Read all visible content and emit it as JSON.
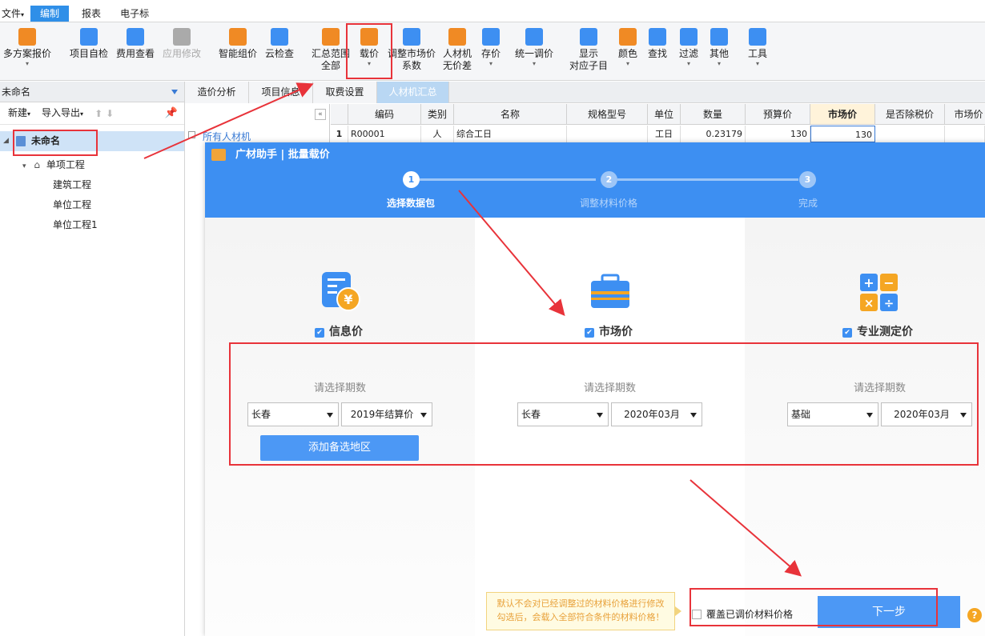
{
  "menu": {
    "items": [
      "文件",
      "编制",
      "报表",
      "电子标"
    ],
    "active_index": 1
  },
  "toolbar": {
    "buttons": [
      {
        "label": "多方案报价",
        "icon": "multi-plan-icon",
        "dropdown": true
      },
      {
        "label": "项目自检",
        "icon": "self-check-icon"
      },
      {
        "label": "费用查看",
        "icon": "fee-view-icon"
      },
      {
        "label": "应用修改",
        "icon": "apply-change-icon",
        "disabled": true
      },
      {
        "label": "智能组价",
        "icon": "smart-price-icon"
      },
      {
        "label": "云检查",
        "icon": "cloud-check-icon"
      },
      {
        "label": "汇总范围",
        "label2": "全部",
        "icon": "summary-range-icon"
      },
      {
        "label": "载价",
        "icon": "load-price-icon",
        "dropdown": true
      },
      {
        "label": "调整市场价",
        "label2": "系数",
        "icon": "adjust-market-icon"
      },
      {
        "label": "人材机",
        "label2": "无价差",
        "icon": "scale-icon"
      },
      {
        "label": "存价",
        "icon": "save-price-icon",
        "dropdown": true
      },
      {
        "label": "统一调价",
        "icon": "unify-price-icon",
        "dropdown": true
      },
      {
        "label": "显示",
        "label2": "对应子目",
        "icon": "show-sub-icon"
      },
      {
        "label": "颜色",
        "icon": "color-bucket-icon",
        "dropdown": true
      },
      {
        "label": "查找",
        "icon": "binoculars-icon"
      },
      {
        "label": "过滤",
        "icon": "filter-icon",
        "dropdown": true
      },
      {
        "label": "其他",
        "icon": "grid-apps-icon",
        "dropdown": true
      },
      {
        "label": "工具",
        "icon": "tools-icon",
        "dropdown": true
      }
    ]
  },
  "sidebar": {
    "project_name": "未命名",
    "new_label": "新建",
    "import_export_label": "导入导出",
    "tree": [
      {
        "label": "未命名",
        "level": 0
      },
      {
        "label": "单项工程",
        "level": 1
      },
      {
        "label": "建筑工程",
        "level": 2
      },
      {
        "label": "单位工程",
        "level": 2
      },
      {
        "label": "单位工程1",
        "level": 2
      }
    ]
  },
  "tabs": [
    "造价分析",
    "项目信息",
    "取费设置",
    "人材机汇总"
  ],
  "subpanel": {
    "label": "所有人材机"
  },
  "grid": {
    "headers": [
      "编码",
      "类别",
      "名称",
      "规格型号",
      "单位",
      "数量",
      "预算价",
      "市场价",
      "是否除税价",
      "市场价"
    ],
    "rows": [
      {
        "num": "1",
        "code": "R00001",
        "type": "人",
        "name": "综合工日",
        "spec": "",
        "unit": "工日",
        "qty": "0.23179",
        "budget": "130",
        "market": "130",
        "tax": "",
        "market2": ""
      }
    ]
  },
  "dialog": {
    "title": "广材助手 | 批量载价",
    "steps": [
      {
        "num": "1",
        "label": "选择数据包",
        "active": true
      },
      {
        "num": "2",
        "label": "调整材料价格",
        "active": false
      },
      {
        "num": "3",
        "label": "完成",
        "active": false
      }
    ],
    "columns": [
      {
        "title": "信息价",
        "prompt": "请选择期数",
        "region": "长春",
        "period": "2019年结算价",
        "checked": true
      },
      {
        "title": "市场价",
        "prompt": "请选择期数",
        "region": "长春",
        "period": "2020年03月",
        "checked": true
      },
      {
        "title": "专业测定价",
        "prompt": "请选择期数",
        "region": "基础",
        "period": "2020年03月",
        "checked": true
      }
    ],
    "add_region_label": "添加备选地区",
    "tip_line1": "默认不会对已经调整过的材料价格进行修改",
    "tip_line2": "勾选后，会载入全部符合条件的材料价格！",
    "overwrite_label": "覆盖已调价材料价格",
    "next_label": "下一步",
    "help": "?"
  },
  "colors": {
    "accent": "#3d8ff2",
    "annotation_red": "#e8333a",
    "tip_bg": "#fffbe2",
    "tip_text": "#e8a13a"
  }
}
